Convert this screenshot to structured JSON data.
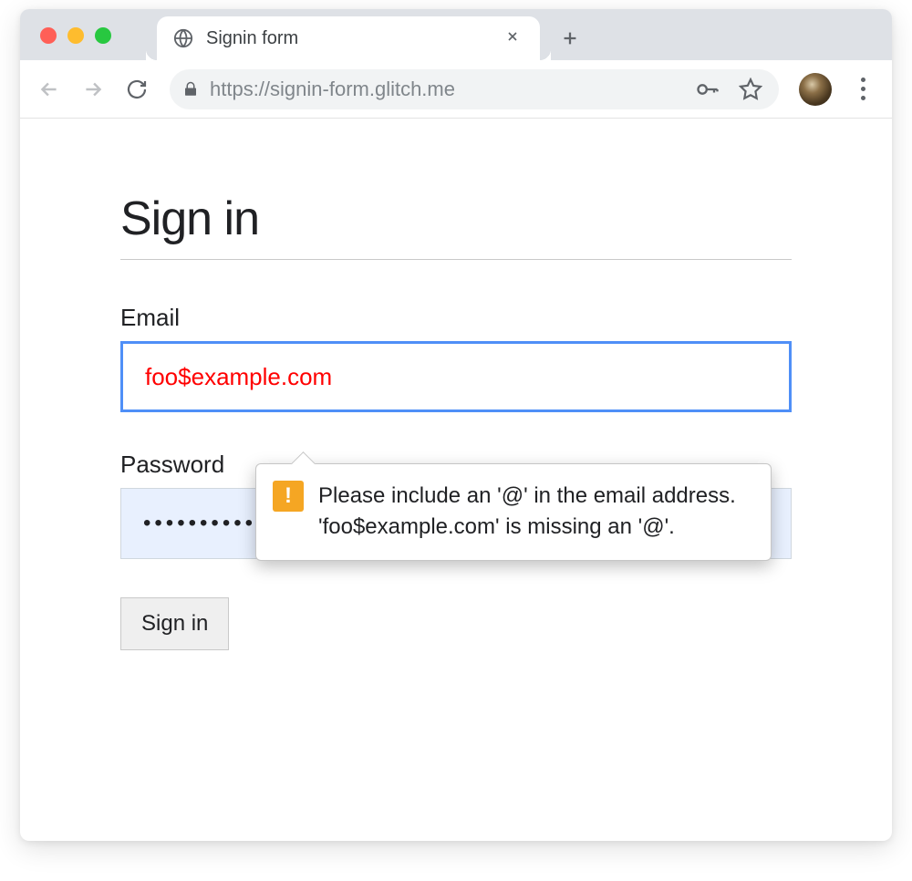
{
  "browser": {
    "tab_title": "Signin form",
    "url": "https://signin-form.glitch.me"
  },
  "page": {
    "heading": "Sign in",
    "email_label": "Email",
    "email_value": "foo$example.com",
    "password_label": "Password",
    "password_value": "••••••••••",
    "submit_label": "Sign in"
  },
  "validation": {
    "message": "Please include an '@' in the email address. 'foo$example.com' is missing an '@'."
  }
}
